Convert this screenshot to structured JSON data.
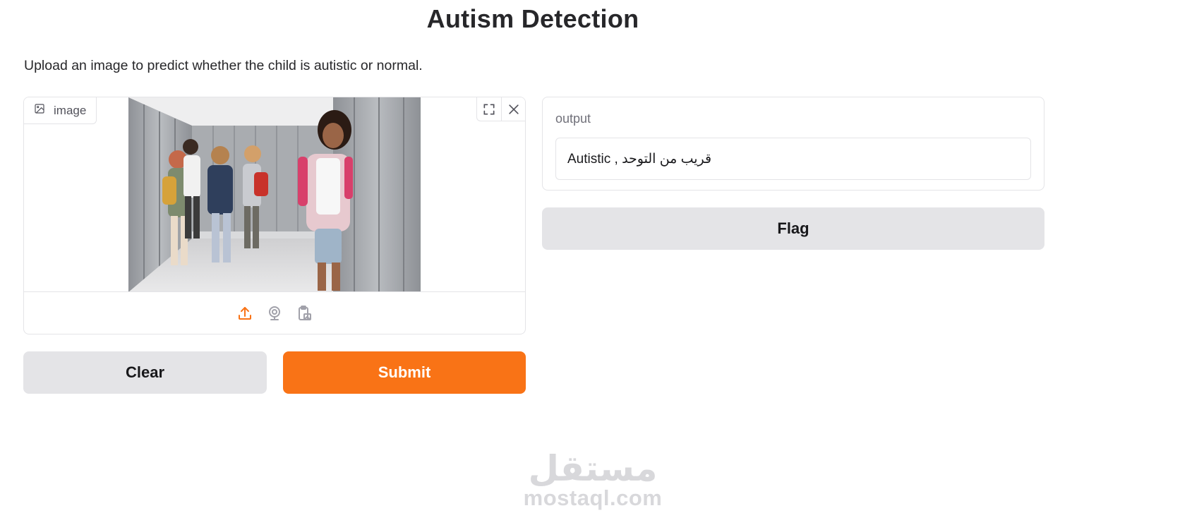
{
  "header": {
    "title": "Autism Detection",
    "description": "Upload an image to predict whether the child is autistic or normal."
  },
  "image_input": {
    "label": "image",
    "label_icon": "image-icon",
    "tools": [
      "fullscreen-icon",
      "close-icon"
    ],
    "sources": [
      "upload-icon",
      "webcam-icon",
      "clipboard-icon"
    ],
    "active_source_color": "#f97316",
    "inactive_source_color": "#a1a1aa"
  },
  "actions": {
    "clear_label": "Clear",
    "submit_label": "Submit",
    "flag_label": "Flag"
  },
  "output": {
    "label": "output",
    "value": "Autistic , قريب من التوحد"
  },
  "watermark": {
    "arabic": "مستقل",
    "latin": "mostaql.com"
  },
  "colors": {
    "accent": "#f97316",
    "secondary_button": "#e4e4e7",
    "border": "#e4e4e7"
  }
}
